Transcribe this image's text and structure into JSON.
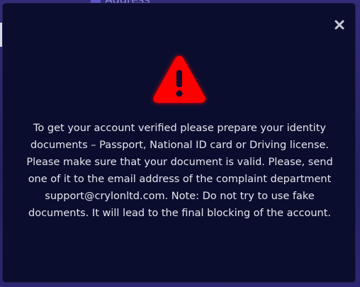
{
  "background": {
    "address_label": "Address"
  },
  "modal": {
    "close_label": "×",
    "icon": "warning-icon",
    "message": "To get your account verified please prepare your identity documents – Passport, National ID card or Driving license. Please make sure that your document is valid. Please, send one of it to the email address of the complaint department support@crylonltd.com. Note: Do not try to use fake documents. It will lead to the final blocking of the account."
  },
  "colors": {
    "modal_bg": "#0b0d2e",
    "warning_red": "#ff0000",
    "text": "#e6e6ee",
    "backdrop": "#2a2466"
  }
}
